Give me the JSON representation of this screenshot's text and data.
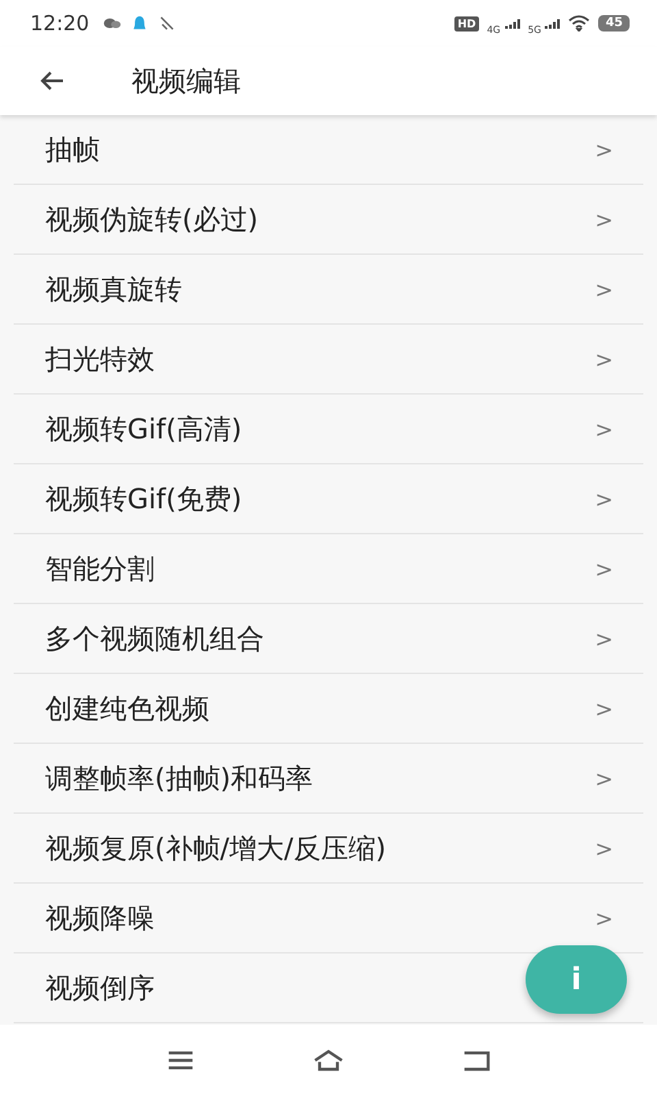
{
  "status_bar": {
    "time": "12:20",
    "hd": "HD",
    "net_1": "4G",
    "net_2": "5G",
    "battery": "45"
  },
  "app_bar": {
    "title": "视频编辑"
  },
  "items": [
    {
      "label": "抽帧",
      "chevron": ">"
    },
    {
      "label": "视频伪旋转(必过)",
      "chevron": ">"
    },
    {
      "label": "视频真旋转",
      "chevron": ">"
    },
    {
      "label": "扫光特效",
      "chevron": ">"
    },
    {
      "label": "视频转Gif(高清)",
      "chevron": ">"
    },
    {
      "label": "视频转Gif(免费)",
      "chevron": ">"
    },
    {
      "label": "智能分割",
      "chevron": ">"
    },
    {
      "label": "多个视频随机组合",
      "chevron": ">"
    },
    {
      "label": "创建纯色视频",
      "chevron": ">"
    },
    {
      "label": "调整帧率(抽帧)和码率",
      "chevron": ">"
    },
    {
      "label": "视频复原(补帧/增大/反压缩)",
      "chevron": ">"
    },
    {
      "label": "视频降噪",
      "chevron": ">"
    },
    {
      "label": "视频倒序"
    }
  ],
  "fab": {
    "label": "i"
  }
}
